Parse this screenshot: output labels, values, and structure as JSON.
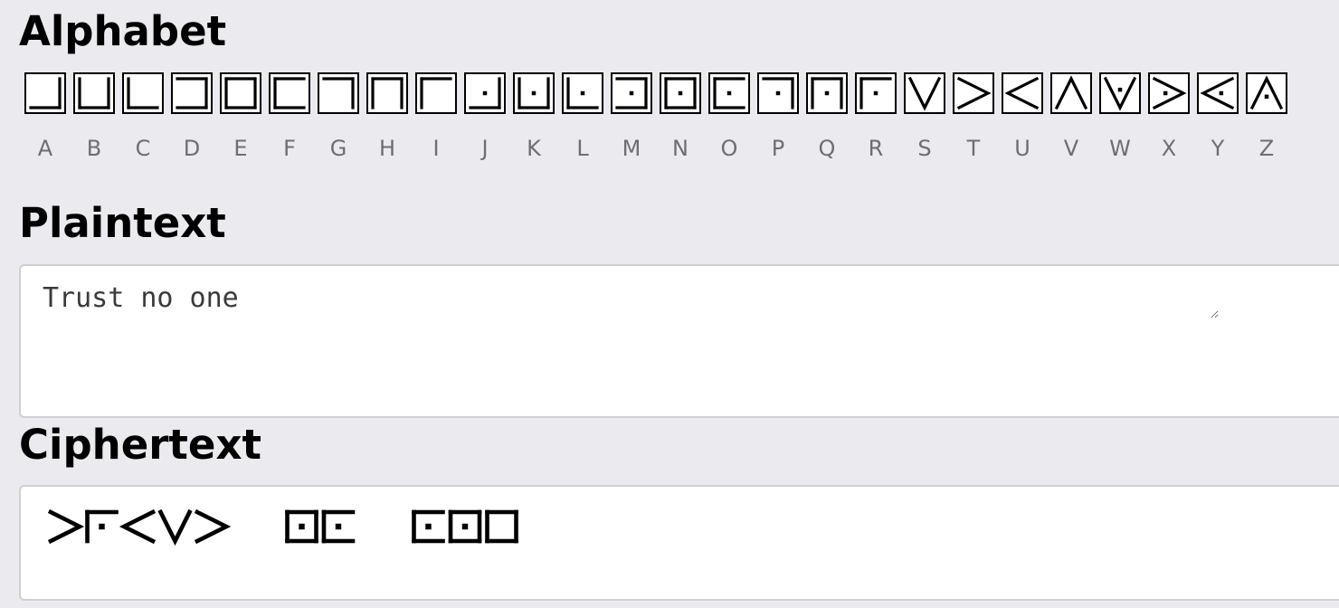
{
  "alphabet": {
    "title": "Alphabet",
    "letters": [
      "A",
      "B",
      "C",
      "D",
      "E",
      "F",
      "G",
      "H",
      "I",
      "J",
      "K",
      "L",
      "M",
      "N",
      "O",
      "P",
      "Q",
      "R",
      "S",
      "T",
      "U",
      "V",
      "W",
      "X",
      "Y",
      "Z"
    ]
  },
  "plaintext": {
    "title": "Plaintext",
    "value": "Trust no one"
  },
  "ciphertext": {
    "title": "Ciphertext"
  },
  "icons": {
    "pigpen_cipher": "pigpen-glyph-icon"
  },
  "colors": {
    "background": "#ebebef",
    "letter_label": "#6d6d73",
    "glyph_stroke": "#000000"
  }
}
